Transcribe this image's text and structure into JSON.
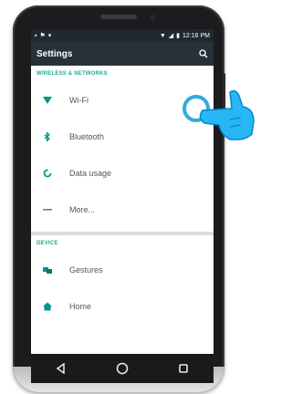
{
  "statusbar": {
    "time": "12:16 PM"
  },
  "appbar": {
    "title": "Settings"
  },
  "sections": [
    {
      "header": "WIRELESS & NETWORKS",
      "items": [
        {
          "label": "Wi-Fi",
          "icon": "wifi-icon"
        },
        {
          "label": "Bluetooth",
          "icon": "bluetooth-icon"
        },
        {
          "label": "Data usage",
          "icon": "data-usage-icon"
        },
        {
          "label": "More...",
          "icon": "more-icon"
        }
      ]
    },
    {
      "header": "DEVICE",
      "items": [
        {
          "label": "Gestures",
          "icon": "gestures-icon"
        },
        {
          "label": "Home",
          "icon": "home-icon"
        }
      ]
    }
  ],
  "colors": {
    "accent": "#26a69a",
    "appbar": "#263238",
    "statusbar": "#1f2a2e",
    "touch": "#33aadd"
  }
}
